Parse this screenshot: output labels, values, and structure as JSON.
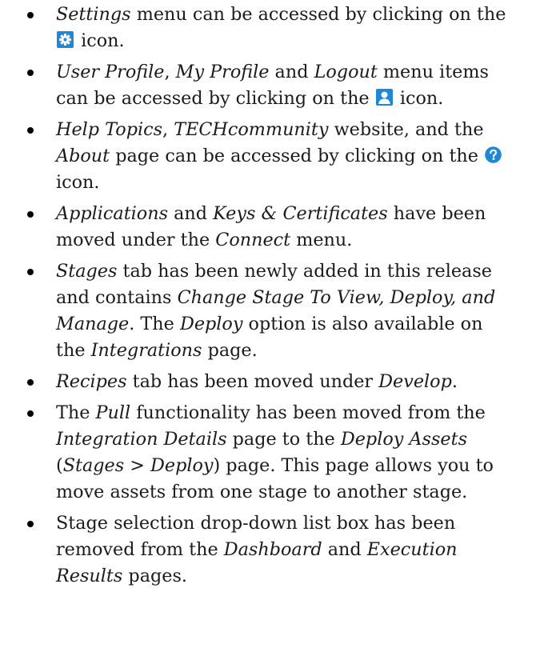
{
  "bullets": [
    {
      "segments": [
        {
          "t": "Settings",
          "i": true
        },
        {
          "t": " menu can be accessed by clicking on the "
        },
        {
          "icon": "gear-icon"
        },
        {
          "t": " icon."
        }
      ]
    },
    {
      "segments": [
        {
          "t": "User Profile",
          "i": true
        },
        {
          "t": ", "
        },
        {
          "t": "My Profile",
          "i": true
        },
        {
          "t": " and "
        },
        {
          "t": "Logout",
          "i": true
        },
        {
          "t": " menu items can be accessed by clicking on the "
        },
        {
          "icon": "user-icon"
        },
        {
          "t": " icon."
        }
      ]
    },
    {
      "segments": [
        {
          "t": "Help Topics",
          "i": true
        },
        {
          "t": ", "
        },
        {
          "t": "TECHcommunity",
          "i": true
        },
        {
          "t": " website, and the "
        },
        {
          "t": "About",
          "i": true
        },
        {
          "t": " page can be accessed by clicking on the "
        },
        {
          "icon": "help-icon"
        },
        {
          "t": " icon."
        }
      ]
    },
    {
      "segments": [
        {
          "t": "Applications",
          "i": true
        },
        {
          "t": " and "
        },
        {
          "t": "Keys & Certificates",
          "i": true
        },
        {
          "t": " have been moved under the "
        },
        {
          "t": "Connect",
          "i": true
        },
        {
          "t": " menu."
        }
      ]
    },
    {
      "segments": [
        {
          "t": "Stages",
          "i": true
        },
        {
          "t": " tab has been newly added in this release and contains "
        },
        {
          "t": "Change Stage To View, Deploy, and Manage",
          "i": true
        },
        {
          "t": ". The "
        },
        {
          "t": "Deploy",
          "i": true
        },
        {
          "t": " option is also available on the "
        },
        {
          "t": "Integrations",
          "i": true
        },
        {
          "t": " page."
        }
      ]
    },
    {
      "segments": [
        {
          "t": "Recipes",
          "i": true
        },
        {
          "t": " tab has been moved under "
        },
        {
          "t": "Develop",
          "i": true
        },
        {
          "t": "."
        }
      ]
    },
    {
      "segments": [
        {
          "t": "The "
        },
        {
          "t": "Pull",
          "i": true
        },
        {
          "t": " functionality has been moved from the "
        },
        {
          "t": "Integration Details",
          "i": true
        },
        {
          "t": " page to the "
        },
        {
          "t": "Deploy Assets",
          "i": true
        },
        {
          "t": " ("
        },
        {
          "t": "Stages",
          "i": true
        },
        {
          "t": " > "
        },
        {
          "t": "Deploy",
          "i": true
        },
        {
          "t": ") page. This page allows you to move assets from one stage to another stage."
        }
      ]
    },
    {
      "segments": [
        {
          "t": "Stage selection drop-down list box has been removed from the "
        },
        {
          "t": "Dashboard",
          "i": true
        },
        {
          "t": " and "
        },
        {
          "t": "Execution Results",
          "i": true
        },
        {
          "t": " pages."
        }
      ]
    }
  ],
  "colors": {
    "icon_blue": "#1e88d8",
    "text": "#1b1b1b"
  }
}
